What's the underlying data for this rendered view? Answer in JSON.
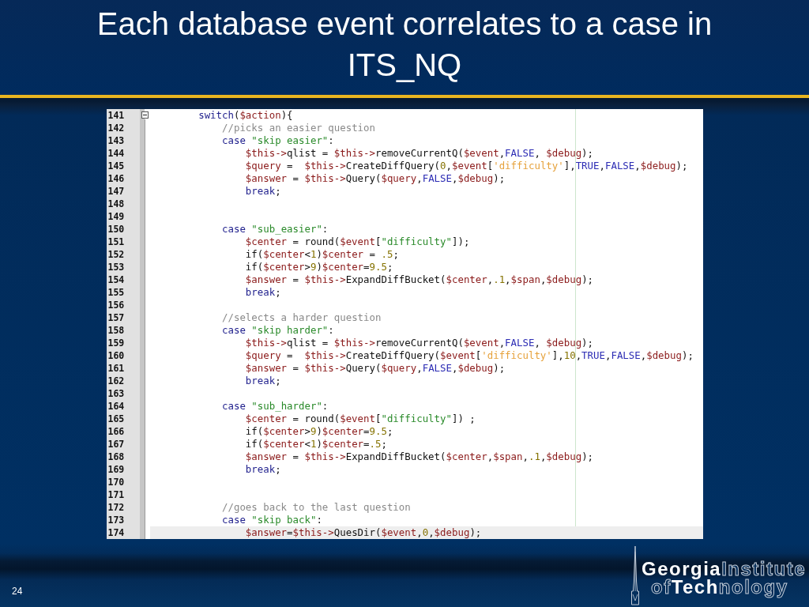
{
  "slide": {
    "title": "Each database event correlates to a case in ITS_NQ",
    "number": "24"
  },
  "editor": {
    "fold": {
      "expanded": true
    },
    "lines": [
      {
        "number": "141",
        "current": false,
        "tokens": [
          {
            "kind": "keyword",
            "text": "        switch"
          },
          {
            "kind": "plain",
            "text": "("
          },
          {
            "kind": "variable",
            "text": "$action"
          },
          {
            "kind": "plain",
            "text": "){"
          }
        ]
      },
      {
        "number": "142",
        "current": false,
        "tokens": [
          {
            "kind": "comment",
            "text": "            //picks an easier question"
          }
        ]
      },
      {
        "number": "143",
        "current": false,
        "tokens": [
          {
            "kind": "keyword",
            "text": "            case "
          },
          {
            "kind": "string",
            "text": "\"skip easier\""
          },
          {
            "kind": "plain",
            "text": ":"
          }
        ]
      },
      {
        "number": "144",
        "current": false,
        "tokens": [
          {
            "kind": "variable",
            "text": "                $this->"
          },
          {
            "kind": "plain",
            "text": "qlist = "
          },
          {
            "kind": "variable",
            "text": "$this->"
          },
          {
            "kind": "plain",
            "text": "removeCurrentQ("
          },
          {
            "kind": "variable",
            "text": "$event"
          },
          {
            "kind": "plain",
            "text": ","
          },
          {
            "kind": "constant",
            "text": "FALSE"
          },
          {
            "kind": "plain",
            "text": ", "
          },
          {
            "kind": "variable",
            "text": "$debug"
          },
          {
            "kind": "plain",
            "text": ");"
          }
        ]
      },
      {
        "number": "145",
        "current": false,
        "tokens": [
          {
            "kind": "variable",
            "text": "                $query"
          },
          {
            "kind": "plain",
            "text": " =  "
          },
          {
            "kind": "variable",
            "text": "$this->"
          },
          {
            "kind": "plain",
            "text": "CreateDiffQuery("
          },
          {
            "kind": "number",
            "text": "0"
          },
          {
            "kind": "plain",
            "text": ","
          },
          {
            "kind": "variable",
            "text": "$event"
          },
          {
            "kind": "plain",
            "text": "["
          },
          {
            "kind": "quote",
            "text": "'difficulty'"
          },
          {
            "kind": "plain",
            "text": "],"
          },
          {
            "kind": "constant",
            "text": "TRUE"
          },
          {
            "kind": "plain",
            "text": ","
          },
          {
            "kind": "constant",
            "text": "FALSE"
          },
          {
            "kind": "plain",
            "text": ","
          },
          {
            "kind": "variable",
            "text": "$debug"
          },
          {
            "kind": "plain",
            "text": ");"
          }
        ]
      },
      {
        "number": "146",
        "current": false,
        "tokens": [
          {
            "kind": "variable",
            "text": "                $answer"
          },
          {
            "kind": "plain",
            "text": " = "
          },
          {
            "kind": "variable",
            "text": "$this->"
          },
          {
            "kind": "plain",
            "text": "Query("
          },
          {
            "kind": "variable",
            "text": "$query"
          },
          {
            "kind": "plain",
            "text": ","
          },
          {
            "kind": "constant",
            "text": "FALSE"
          },
          {
            "kind": "plain",
            "text": ","
          },
          {
            "kind": "variable",
            "text": "$debug"
          },
          {
            "kind": "plain",
            "text": ");"
          }
        ]
      },
      {
        "number": "147",
        "current": false,
        "tokens": [
          {
            "kind": "keyword",
            "text": "                break"
          },
          {
            "kind": "plain",
            "text": ";"
          }
        ]
      },
      {
        "number": "148",
        "current": false
      },
      {
        "number": "149",
        "current": false
      },
      {
        "number": "150",
        "current": false,
        "tokens": [
          {
            "kind": "keyword",
            "text": "            case "
          },
          {
            "kind": "string",
            "text": "\"sub_easier\""
          },
          {
            "kind": "plain",
            "text": ":"
          }
        ]
      },
      {
        "number": "151",
        "current": false,
        "tokens": [
          {
            "kind": "variable",
            "text": "                $center"
          },
          {
            "kind": "plain",
            "text": " = round("
          },
          {
            "kind": "variable",
            "text": "$event"
          },
          {
            "kind": "plain",
            "text": "["
          },
          {
            "kind": "string",
            "text": "\"difficulty\""
          },
          {
            "kind": "plain",
            "text": "]);"
          }
        ]
      },
      {
        "number": "152",
        "current": false,
        "tokens": [
          {
            "kind": "plain",
            "text": "                if("
          },
          {
            "kind": "variable",
            "text": "$center"
          },
          {
            "kind": "plain",
            "text": "<"
          },
          {
            "kind": "number",
            "text": "1"
          },
          {
            "kind": "plain",
            "text": ")"
          },
          {
            "kind": "variable",
            "text": "$center"
          },
          {
            "kind": "plain",
            "text": " = "
          },
          {
            "kind": "number",
            "text": ".5"
          },
          {
            "kind": "plain",
            "text": ";"
          }
        ]
      },
      {
        "number": "153",
        "current": false,
        "tokens": [
          {
            "kind": "plain",
            "text": "                if("
          },
          {
            "kind": "variable",
            "text": "$center"
          },
          {
            "kind": "plain",
            "text": ">"
          },
          {
            "kind": "number",
            "text": "9"
          },
          {
            "kind": "plain",
            "text": ")"
          },
          {
            "kind": "variable",
            "text": "$center"
          },
          {
            "kind": "plain",
            "text": "="
          },
          {
            "kind": "number",
            "text": "9.5"
          },
          {
            "kind": "plain",
            "text": ";"
          }
        ]
      },
      {
        "number": "154",
        "current": false,
        "tokens": [
          {
            "kind": "variable",
            "text": "                $answer"
          },
          {
            "kind": "plain",
            "text": " = "
          },
          {
            "kind": "variable",
            "text": "$this->"
          },
          {
            "kind": "plain",
            "text": "ExpandDiffBucket("
          },
          {
            "kind": "variable",
            "text": "$center"
          },
          {
            "kind": "plain",
            "text": ","
          },
          {
            "kind": "number",
            "text": ".1"
          },
          {
            "kind": "plain",
            "text": ","
          },
          {
            "kind": "variable",
            "text": "$span"
          },
          {
            "kind": "plain",
            "text": ","
          },
          {
            "kind": "variable",
            "text": "$debug"
          },
          {
            "kind": "plain",
            "text": ");"
          }
        ]
      },
      {
        "number": "155",
        "current": false,
        "tokens": [
          {
            "kind": "keyword",
            "text": "                break"
          },
          {
            "kind": "plain",
            "text": ";"
          }
        ]
      },
      {
        "number": "156",
        "current": false
      },
      {
        "number": "157",
        "current": false,
        "tokens": [
          {
            "kind": "comment",
            "text": "            //selects a harder question"
          }
        ]
      },
      {
        "number": "158",
        "current": false,
        "tokens": [
          {
            "kind": "keyword",
            "text": "            case "
          },
          {
            "kind": "string",
            "text": "\"skip harder\""
          },
          {
            "kind": "plain",
            "text": ":"
          }
        ]
      },
      {
        "number": "159",
        "current": false,
        "tokens": [
          {
            "kind": "variable",
            "text": "                $this->"
          },
          {
            "kind": "plain",
            "text": "qlist = "
          },
          {
            "kind": "variable",
            "text": "$this->"
          },
          {
            "kind": "plain",
            "text": "removeCurrentQ("
          },
          {
            "kind": "variable",
            "text": "$event"
          },
          {
            "kind": "plain",
            "text": ","
          },
          {
            "kind": "constant",
            "text": "FALSE"
          },
          {
            "kind": "plain",
            "text": ", "
          },
          {
            "kind": "variable",
            "text": "$debug"
          },
          {
            "kind": "plain",
            "text": ");"
          }
        ]
      },
      {
        "number": "160",
        "current": false,
        "tokens": [
          {
            "kind": "variable",
            "text": "                $query"
          },
          {
            "kind": "plain",
            "text": " =  "
          },
          {
            "kind": "variable",
            "text": "$this->"
          },
          {
            "kind": "plain",
            "text": "CreateDiffQuery("
          },
          {
            "kind": "variable",
            "text": "$event"
          },
          {
            "kind": "plain",
            "text": "["
          },
          {
            "kind": "quote",
            "text": "'difficulty'"
          },
          {
            "kind": "plain",
            "text": "],"
          },
          {
            "kind": "number",
            "text": "10"
          },
          {
            "kind": "plain",
            "text": ","
          },
          {
            "kind": "constant",
            "text": "TRUE"
          },
          {
            "kind": "plain",
            "text": ","
          },
          {
            "kind": "constant",
            "text": "FALSE"
          },
          {
            "kind": "plain",
            "text": ","
          },
          {
            "kind": "variable",
            "text": "$debug"
          },
          {
            "kind": "plain",
            "text": ");"
          }
        ]
      },
      {
        "number": "161",
        "current": false,
        "tokens": [
          {
            "kind": "variable",
            "text": "                $answer"
          },
          {
            "kind": "plain",
            "text": " = "
          },
          {
            "kind": "variable",
            "text": "$this->"
          },
          {
            "kind": "plain",
            "text": "Query("
          },
          {
            "kind": "variable",
            "text": "$query"
          },
          {
            "kind": "plain",
            "text": ","
          },
          {
            "kind": "constant",
            "text": "FALSE"
          },
          {
            "kind": "plain",
            "text": ","
          },
          {
            "kind": "variable",
            "text": "$debug"
          },
          {
            "kind": "plain",
            "text": ");"
          }
        ]
      },
      {
        "number": "162",
        "current": false,
        "tokens": [
          {
            "kind": "keyword",
            "text": "                break"
          },
          {
            "kind": "plain",
            "text": ";"
          }
        ]
      },
      {
        "number": "163",
        "current": false
      },
      {
        "number": "164",
        "current": false,
        "tokens": [
          {
            "kind": "keyword",
            "text": "            case "
          },
          {
            "kind": "string",
            "text": "\"sub_harder\""
          },
          {
            "kind": "plain",
            "text": ":"
          }
        ]
      },
      {
        "number": "165",
        "current": false,
        "tokens": [
          {
            "kind": "variable",
            "text": "                $center"
          },
          {
            "kind": "plain",
            "text": " = round("
          },
          {
            "kind": "variable",
            "text": "$event"
          },
          {
            "kind": "plain",
            "text": "["
          },
          {
            "kind": "string",
            "text": "\"difficulty\""
          },
          {
            "kind": "plain",
            "text": "]) ;"
          }
        ]
      },
      {
        "number": "166",
        "current": false,
        "tokens": [
          {
            "kind": "plain",
            "text": "                if("
          },
          {
            "kind": "variable",
            "text": "$center"
          },
          {
            "kind": "plain",
            "text": ">"
          },
          {
            "kind": "number",
            "text": "9"
          },
          {
            "kind": "plain",
            "text": ")"
          },
          {
            "kind": "variable",
            "text": "$center"
          },
          {
            "kind": "plain",
            "text": "="
          },
          {
            "kind": "number",
            "text": "9.5"
          },
          {
            "kind": "plain",
            "text": ";"
          }
        ]
      },
      {
        "number": "167",
        "current": false,
        "tokens": [
          {
            "kind": "plain",
            "text": "                if("
          },
          {
            "kind": "variable",
            "text": "$center"
          },
          {
            "kind": "plain",
            "text": "<"
          },
          {
            "kind": "number",
            "text": "1"
          },
          {
            "kind": "plain",
            "text": ")"
          },
          {
            "kind": "variable",
            "text": "$center"
          },
          {
            "kind": "plain",
            "text": "="
          },
          {
            "kind": "number",
            "text": ".5"
          },
          {
            "kind": "plain",
            "text": ";"
          }
        ]
      },
      {
        "number": "168",
        "current": false,
        "tokens": [
          {
            "kind": "variable",
            "text": "                $answer"
          },
          {
            "kind": "plain",
            "text": " = "
          },
          {
            "kind": "variable",
            "text": "$this->"
          },
          {
            "kind": "plain",
            "text": "ExpandDiffBucket("
          },
          {
            "kind": "variable",
            "text": "$center"
          },
          {
            "kind": "plain",
            "text": ","
          },
          {
            "kind": "variable",
            "text": "$span"
          },
          {
            "kind": "plain",
            "text": ","
          },
          {
            "kind": "number",
            "text": ".1"
          },
          {
            "kind": "plain",
            "text": ","
          },
          {
            "kind": "variable",
            "text": "$debug"
          },
          {
            "kind": "plain",
            "text": ");"
          }
        ]
      },
      {
        "number": "169",
        "current": false,
        "tokens": [
          {
            "kind": "keyword",
            "text": "                break"
          },
          {
            "kind": "plain",
            "text": ";"
          }
        ]
      },
      {
        "number": "170",
        "current": false
      },
      {
        "number": "171",
        "current": false
      },
      {
        "number": "172",
        "current": false,
        "tokens": [
          {
            "kind": "comment",
            "text": "            //goes back to the last question"
          }
        ]
      },
      {
        "number": "173",
        "current": false,
        "tokens": [
          {
            "kind": "keyword",
            "text": "            case "
          },
          {
            "kind": "string",
            "text": "\"skip back\""
          },
          {
            "kind": "plain",
            "text": ":"
          }
        ]
      },
      {
        "number": "174",
        "current": true,
        "tokens": [
          {
            "kind": "variable",
            "text": "                $answer"
          },
          {
            "kind": "plain",
            "text": "="
          },
          {
            "kind": "variable",
            "text": "$this->"
          },
          {
            "kind": "plain",
            "text": "QuesDir("
          },
          {
            "kind": "variable",
            "text": "$event"
          },
          {
            "kind": "plain",
            "text": ","
          },
          {
            "kind": "number",
            "text": "0"
          },
          {
            "kind": "plain",
            "text": ","
          },
          {
            "kind": "variable",
            "text": "$debug"
          },
          {
            "kind": "plain",
            "text": ");"
          }
        ]
      }
    ]
  },
  "logo": {
    "lines": [
      "**Georgia**Institute",
      "of**Tech**nology"
    ]
  }
}
